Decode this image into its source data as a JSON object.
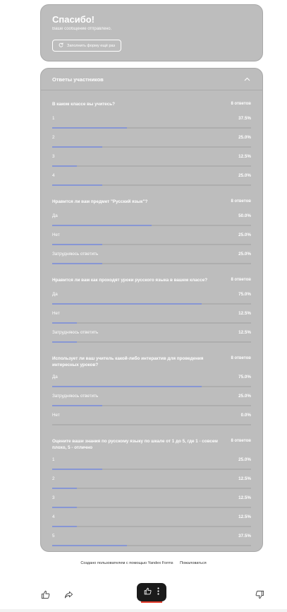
{
  "thanks": {
    "title": "Спасибо!",
    "subtitle": "Ваше сообщение отправлено.",
    "refill_label": "Заполнить форму ещё раз"
  },
  "answers": {
    "title": "Ответы участников",
    "questions": [
      {
        "title": "В каком классе вы учитесь?",
        "count": "8 ответов",
        "options": [
          {
            "label": "1",
            "pct_label": "37.5%",
            "percent": 37.5
          },
          {
            "label": "2",
            "pct_label": "25.0%",
            "percent": 25.0
          },
          {
            "label": "3",
            "pct_label": "12.5%",
            "percent": 12.5
          },
          {
            "label": "4",
            "pct_label": "25.0%",
            "percent": 25.0
          }
        ]
      },
      {
        "title": "Нравится ли вам предмет \"Русский язык\"?",
        "count": "8 ответов",
        "options": [
          {
            "label": "Да",
            "pct_label": "50.0%",
            "percent": 50.0
          },
          {
            "label": "Нет",
            "pct_label": "25.0%",
            "percent": 25.0
          },
          {
            "label": "Затрудняюсь ответить",
            "pct_label": "25.0%",
            "percent": 25.0
          }
        ]
      },
      {
        "title": "Нравится ли вам как проходят уроки русского языка в вашем классе?",
        "count": "8 ответов",
        "options": [
          {
            "label": "Да",
            "pct_label": "75.0%",
            "percent": 75.0
          },
          {
            "label": "Нет",
            "pct_label": "12.5%",
            "percent": 12.5
          },
          {
            "label": "Затрудняюсь ответить",
            "pct_label": "12.5%",
            "percent": 12.5
          }
        ]
      },
      {
        "title": "Использует ли ваш учитель какой-либо интерактив для проведения интересных уроков?",
        "count": "8 ответов",
        "options": [
          {
            "label": "Да",
            "pct_label": "75.0%",
            "percent": 75.0
          },
          {
            "label": "Затрудняюсь ответить",
            "pct_label": "25.0%",
            "percent": 25.0
          },
          {
            "label": "Нет",
            "pct_label": "0.0%",
            "percent": 0.0
          }
        ]
      },
      {
        "title": "Оцените ваши знания по русскому языку по шкале от 1 до 5, где 1 - совсем плохо, 5 - отлично",
        "count": "8 ответов",
        "options": [
          {
            "label": "1",
            "pct_label": "25.0%",
            "percent": 25.0
          },
          {
            "label": "2",
            "pct_label": "12.5%",
            "percent": 12.5
          },
          {
            "label": "3",
            "pct_label": "12.5%",
            "percent": 12.5
          },
          {
            "label": "4",
            "pct_label": "12.5%",
            "percent": 12.5
          },
          {
            "label": "5",
            "pct_label": "37.5%",
            "percent": 37.5
          }
        ]
      }
    ]
  },
  "footer": {
    "created_text": "Создано пользователем с помощью Yandex Forms",
    "report_link": "Пожаловаться"
  },
  "colors": {
    "card_bg": "#bdbdbd",
    "bar_fill": "#8796d4",
    "pill_bg": "#1a1a1a",
    "pill_accent": "#e23a2a"
  },
  "icons": {
    "refill": "refresh-icon",
    "collapse": "chevron-up-icon",
    "like": "thumbs-up-icon",
    "share": "share-arrow-icon",
    "more": "more-vertical-icon",
    "dislike": "thumbs-down-icon"
  }
}
